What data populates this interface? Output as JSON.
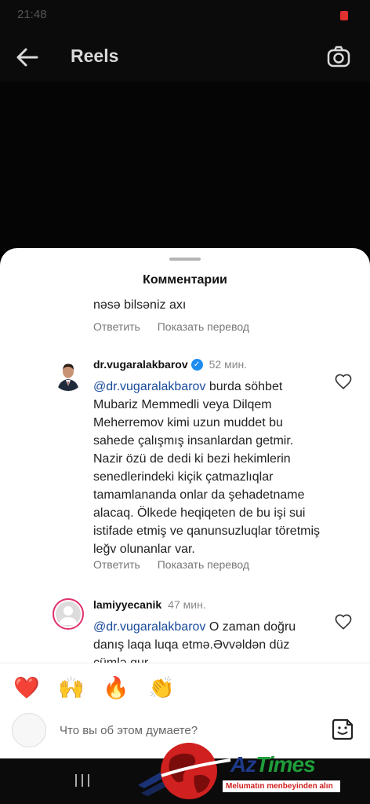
{
  "status_bar": {
    "time": "21:48"
  },
  "header": {
    "title": "Reels"
  },
  "sheet": {
    "title": "Комментарии"
  },
  "actions": {
    "reply": "Ответить",
    "translate": "Показать перевод"
  },
  "previous_comment": {
    "text": "nəsə bilsəniz axı"
  },
  "comments": [
    {
      "username": "dr.vugaralakbarov",
      "time": "52 мин.",
      "mention": "@dr.vugaralakbarov",
      "text": " burda söhbet Mubariz Memmedli veya Dilqem Meherremov kimi uzun muddet  bu sahede çalışmış insanlardan getmir. Nazir özü de dedi ki bezi hekimlerin senedlerindeki kiçik çatmazlıqlar tamamlananda onlar da şehadetname alacaq. Ölkede heqiqeten de bu işi sui istifade etmiş ve qanunsuzluqlar töretmiş leğv olunanlar var."
    },
    {
      "username": "lamiyyecanik",
      "time": "47 мин.",
      "mention": "@dr.vugaralakbarov",
      "text": " O zaman doğru danış laqa luqa etmə.Əvvəldən düz cümlə qur."
    }
  ],
  "emojis": [
    "❤️",
    "🙌",
    "🔥",
    "👏",
    "😢",
    "😍",
    "😮",
    "😂"
  ],
  "comment_input": {
    "placeholder": "Что вы об этом думаете?"
  },
  "watermark": {
    "brand_a": "Az",
    "brand_b": "Times",
    "tagline": "Melumatın menbeyinden alın"
  }
}
